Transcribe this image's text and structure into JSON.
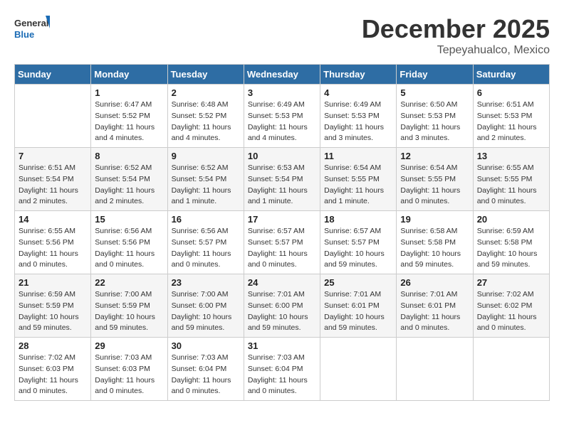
{
  "header": {
    "logo_general": "General",
    "logo_blue": "Blue",
    "month_title": "December 2025",
    "location": "Tepeyahualco, Mexico"
  },
  "weekdays": [
    "Sunday",
    "Monday",
    "Tuesday",
    "Wednesday",
    "Thursday",
    "Friday",
    "Saturday"
  ],
  "weeks": [
    [
      {
        "day": "",
        "info": ""
      },
      {
        "day": "1",
        "info": "Sunrise: 6:47 AM\nSunset: 5:52 PM\nDaylight: 11 hours\nand 4 minutes."
      },
      {
        "day": "2",
        "info": "Sunrise: 6:48 AM\nSunset: 5:52 PM\nDaylight: 11 hours\nand 4 minutes."
      },
      {
        "day": "3",
        "info": "Sunrise: 6:49 AM\nSunset: 5:53 PM\nDaylight: 11 hours\nand 4 minutes."
      },
      {
        "day": "4",
        "info": "Sunrise: 6:49 AM\nSunset: 5:53 PM\nDaylight: 11 hours\nand 3 minutes."
      },
      {
        "day": "5",
        "info": "Sunrise: 6:50 AM\nSunset: 5:53 PM\nDaylight: 11 hours\nand 3 minutes."
      },
      {
        "day": "6",
        "info": "Sunrise: 6:51 AM\nSunset: 5:53 PM\nDaylight: 11 hours\nand 2 minutes."
      }
    ],
    [
      {
        "day": "7",
        "info": "Sunrise: 6:51 AM\nSunset: 5:54 PM\nDaylight: 11 hours\nand 2 minutes."
      },
      {
        "day": "8",
        "info": "Sunrise: 6:52 AM\nSunset: 5:54 PM\nDaylight: 11 hours\nand 2 minutes."
      },
      {
        "day": "9",
        "info": "Sunrise: 6:52 AM\nSunset: 5:54 PM\nDaylight: 11 hours\nand 1 minute."
      },
      {
        "day": "10",
        "info": "Sunrise: 6:53 AM\nSunset: 5:54 PM\nDaylight: 11 hours\nand 1 minute."
      },
      {
        "day": "11",
        "info": "Sunrise: 6:54 AM\nSunset: 5:55 PM\nDaylight: 11 hours\nand 1 minute."
      },
      {
        "day": "12",
        "info": "Sunrise: 6:54 AM\nSunset: 5:55 PM\nDaylight: 11 hours\nand 0 minutes."
      },
      {
        "day": "13",
        "info": "Sunrise: 6:55 AM\nSunset: 5:55 PM\nDaylight: 11 hours\nand 0 minutes."
      }
    ],
    [
      {
        "day": "14",
        "info": "Sunrise: 6:55 AM\nSunset: 5:56 PM\nDaylight: 11 hours\nand 0 minutes."
      },
      {
        "day": "15",
        "info": "Sunrise: 6:56 AM\nSunset: 5:56 PM\nDaylight: 11 hours\nand 0 minutes."
      },
      {
        "day": "16",
        "info": "Sunrise: 6:56 AM\nSunset: 5:57 PM\nDaylight: 11 hours\nand 0 minutes."
      },
      {
        "day": "17",
        "info": "Sunrise: 6:57 AM\nSunset: 5:57 PM\nDaylight: 11 hours\nand 0 minutes."
      },
      {
        "day": "18",
        "info": "Sunrise: 6:57 AM\nSunset: 5:57 PM\nDaylight: 10 hours\nand 59 minutes."
      },
      {
        "day": "19",
        "info": "Sunrise: 6:58 AM\nSunset: 5:58 PM\nDaylight: 10 hours\nand 59 minutes."
      },
      {
        "day": "20",
        "info": "Sunrise: 6:59 AM\nSunset: 5:58 PM\nDaylight: 10 hours\nand 59 minutes."
      }
    ],
    [
      {
        "day": "21",
        "info": "Sunrise: 6:59 AM\nSunset: 5:59 PM\nDaylight: 10 hours\nand 59 minutes."
      },
      {
        "day": "22",
        "info": "Sunrise: 7:00 AM\nSunset: 5:59 PM\nDaylight: 10 hours\nand 59 minutes."
      },
      {
        "day": "23",
        "info": "Sunrise: 7:00 AM\nSunset: 6:00 PM\nDaylight: 10 hours\nand 59 minutes."
      },
      {
        "day": "24",
        "info": "Sunrise: 7:01 AM\nSunset: 6:00 PM\nDaylight: 10 hours\nand 59 minutes."
      },
      {
        "day": "25",
        "info": "Sunrise: 7:01 AM\nSunset: 6:01 PM\nDaylight: 10 hours\nand 59 minutes."
      },
      {
        "day": "26",
        "info": "Sunrise: 7:01 AM\nSunset: 6:01 PM\nDaylight: 11 hours\nand 0 minutes."
      },
      {
        "day": "27",
        "info": "Sunrise: 7:02 AM\nSunset: 6:02 PM\nDaylight: 11 hours\nand 0 minutes."
      }
    ],
    [
      {
        "day": "28",
        "info": "Sunrise: 7:02 AM\nSunset: 6:03 PM\nDaylight: 11 hours\nand 0 minutes."
      },
      {
        "day": "29",
        "info": "Sunrise: 7:03 AM\nSunset: 6:03 PM\nDaylight: 11 hours\nand 0 minutes."
      },
      {
        "day": "30",
        "info": "Sunrise: 7:03 AM\nSunset: 6:04 PM\nDaylight: 11 hours\nand 0 minutes."
      },
      {
        "day": "31",
        "info": "Sunrise: 7:03 AM\nSunset: 6:04 PM\nDaylight: 11 hours\nand 0 minutes."
      },
      {
        "day": "",
        "info": ""
      },
      {
        "day": "",
        "info": ""
      },
      {
        "day": "",
        "info": ""
      }
    ]
  ]
}
